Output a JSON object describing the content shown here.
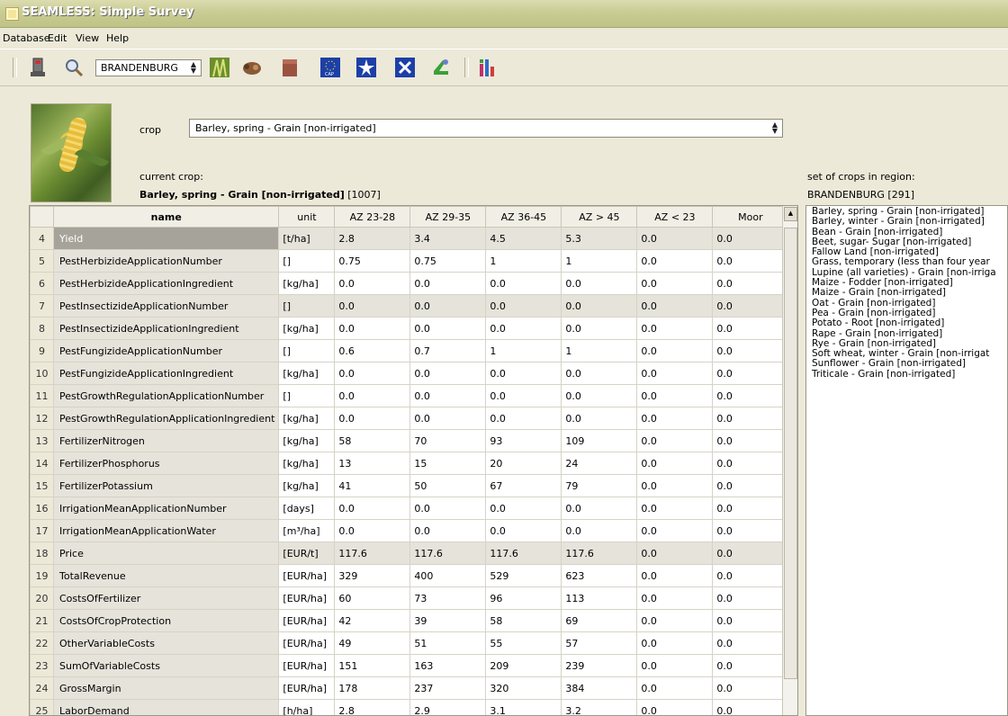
{
  "window": {
    "title": "SEAMLESS: Simple Survey"
  },
  "menu": [
    "Database",
    "Edit",
    "View",
    "Help"
  ],
  "toolbar": {
    "region": "BRANDENBURG"
  },
  "crop_selector": {
    "label": "crop",
    "value": "Barley, spring - Grain [non-irrigated]"
  },
  "current_crop": {
    "label": "current crop:",
    "name": "Barley, spring - Grain [non-irrigated]",
    "id": "[1007]"
  },
  "region_crops": {
    "label": "set of crops in region:",
    "region": "BRANDENBURG [291]"
  },
  "columns": [
    "name",
    "unit",
    "AZ 23-28",
    "AZ 29-35",
    "AZ 36-45",
    "AZ > 45",
    "AZ < 23",
    "Moor"
  ],
  "rows": [
    [
      "4",
      "Yield",
      "[t/ha]",
      "2.8",
      "3.4",
      "4.5",
      "5.3",
      "0.0",
      "0.0"
    ],
    [
      "5",
      "PestHerbizideApplicationNumber",
      "[]",
      "0.75",
      "0.75",
      "1",
      "1",
      "0.0",
      "0.0"
    ],
    [
      "6",
      "PestHerbizideApplicationIngredient",
      "[kg/ha]",
      "0.0",
      "0.0",
      "0.0",
      "0.0",
      "0.0",
      "0.0"
    ],
    [
      "7",
      "PestInsectizideApplicationNumber",
      "[]",
      "0.0",
      "0.0",
      "0.0",
      "0.0",
      "0.0",
      "0.0"
    ],
    [
      "8",
      "PestInsectizideApplicationIngredient",
      "[kg/ha]",
      "0.0",
      "0.0",
      "0.0",
      "0.0",
      "0.0",
      "0.0"
    ],
    [
      "9",
      "PestFungizideApplicationNumber",
      "[]",
      "0.6",
      "0.7",
      "1",
      "1",
      "0.0",
      "0.0"
    ],
    [
      "10",
      "PestFungizideApplicationIngredient",
      "[kg/ha]",
      "0.0",
      "0.0",
      "0.0",
      "0.0",
      "0.0",
      "0.0"
    ],
    [
      "11",
      "PestGrowthRegulationApplicationNumber",
      "[]",
      "0.0",
      "0.0",
      "0.0",
      "0.0",
      "0.0",
      "0.0"
    ],
    [
      "12",
      "PestGrowthRegulationApplicationIngredient",
      "[kg/ha]",
      "0.0",
      "0.0",
      "0.0",
      "0.0",
      "0.0",
      "0.0"
    ],
    [
      "13",
      "FertilizerNitrogen",
      "[kg/ha]",
      "58",
      "70",
      "93",
      "109",
      "0.0",
      "0.0"
    ],
    [
      "14",
      "FertilizerPhosphorus",
      "[kg/ha]",
      "13",
      "15",
      "20",
      "24",
      "0.0",
      "0.0"
    ],
    [
      "15",
      "FertilizerPotassium",
      "[kg/ha]",
      "41",
      "50",
      "67",
      "79",
      "0.0",
      "0.0"
    ],
    [
      "16",
      "IrrigationMeanApplicationNumber",
      "[days]",
      "0.0",
      "0.0",
      "0.0",
      "0.0",
      "0.0",
      "0.0"
    ],
    [
      "17",
      "IrrigationMeanApplicationWater",
      "[m³/ha]",
      "0.0",
      "0.0",
      "0.0",
      "0.0",
      "0.0",
      "0.0"
    ],
    [
      "18",
      "Price",
      "[EUR/t]",
      "117.6",
      "117.6",
      "117.6",
      "117.6",
      "0.0",
      "0.0"
    ],
    [
      "19",
      "TotalRevenue",
      "[EUR/ha]",
      "329",
      "400",
      "529",
      "623",
      "0.0",
      "0.0"
    ],
    [
      "20",
      "CostsOfFertilizer",
      "[EUR/ha]",
      "60",
      "73",
      "96",
      "113",
      "0.0",
      "0.0"
    ],
    [
      "21",
      "CostsOfCropProtection",
      "[EUR/ha]",
      "42",
      "39",
      "58",
      "69",
      "0.0",
      "0.0"
    ],
    [
      "22",
      "OtherVariableCosts",
      "[EUR/ha]",
      "49",
      "51",
      "55",
      "57",
      "0.0",
      "0.0"
    ],
    [
      "23",
      "SumOfVariableCosts",
      "[EUR/ha]",
      "151",
      "163",
      "209",
      "239",
      "0.0",
      "0.0"
    ],
    [
      "24",
      "GrossMargin",
      "[EUR/ha]",
      "178",
      "237",
      "320",
      "384",
      "0.0",
      "0.0"
    ],
    [
      "25",
      "LaborDemand",
      "[h/ha]",
      "2.8",
      "2.9",
      "3.1",
      "3.2",
      "0.0",
      "0.0"
    ]
  ],
  "crop_list": [
    "Barley, spring - Grain [non-irrigated]",
    "Barley, winter - Grain [non-irrigated]",
    "Bean - Grain [non-irrigated]",
    "Beet, sugar- Sugar [non-irrigated]",
    "Fallow Land [non-irrigated]",
    "Grass, temporary (less than four year",
    "Lupine (all varieties) - Grain [non-irriga",
    "Maize - Fodder [non-irrigated]",
    "Maize - Grain [non-irrigated]",
    "Oat - Grain [non-irrigated]",
    "Pea - Grain [non-irrigated]",
    "Potato - Root [non-irrigated]",
    "Rape - Grain [non-irrigated]",
    "Rye - Grain [non-irrigated]",
    "Soft wheat, winter - Grain [non-irrigat",
    "Sunflower - Grain [non-irrigated]",
    "Triticale - Grain [non-irrigated]"
  ]
}
